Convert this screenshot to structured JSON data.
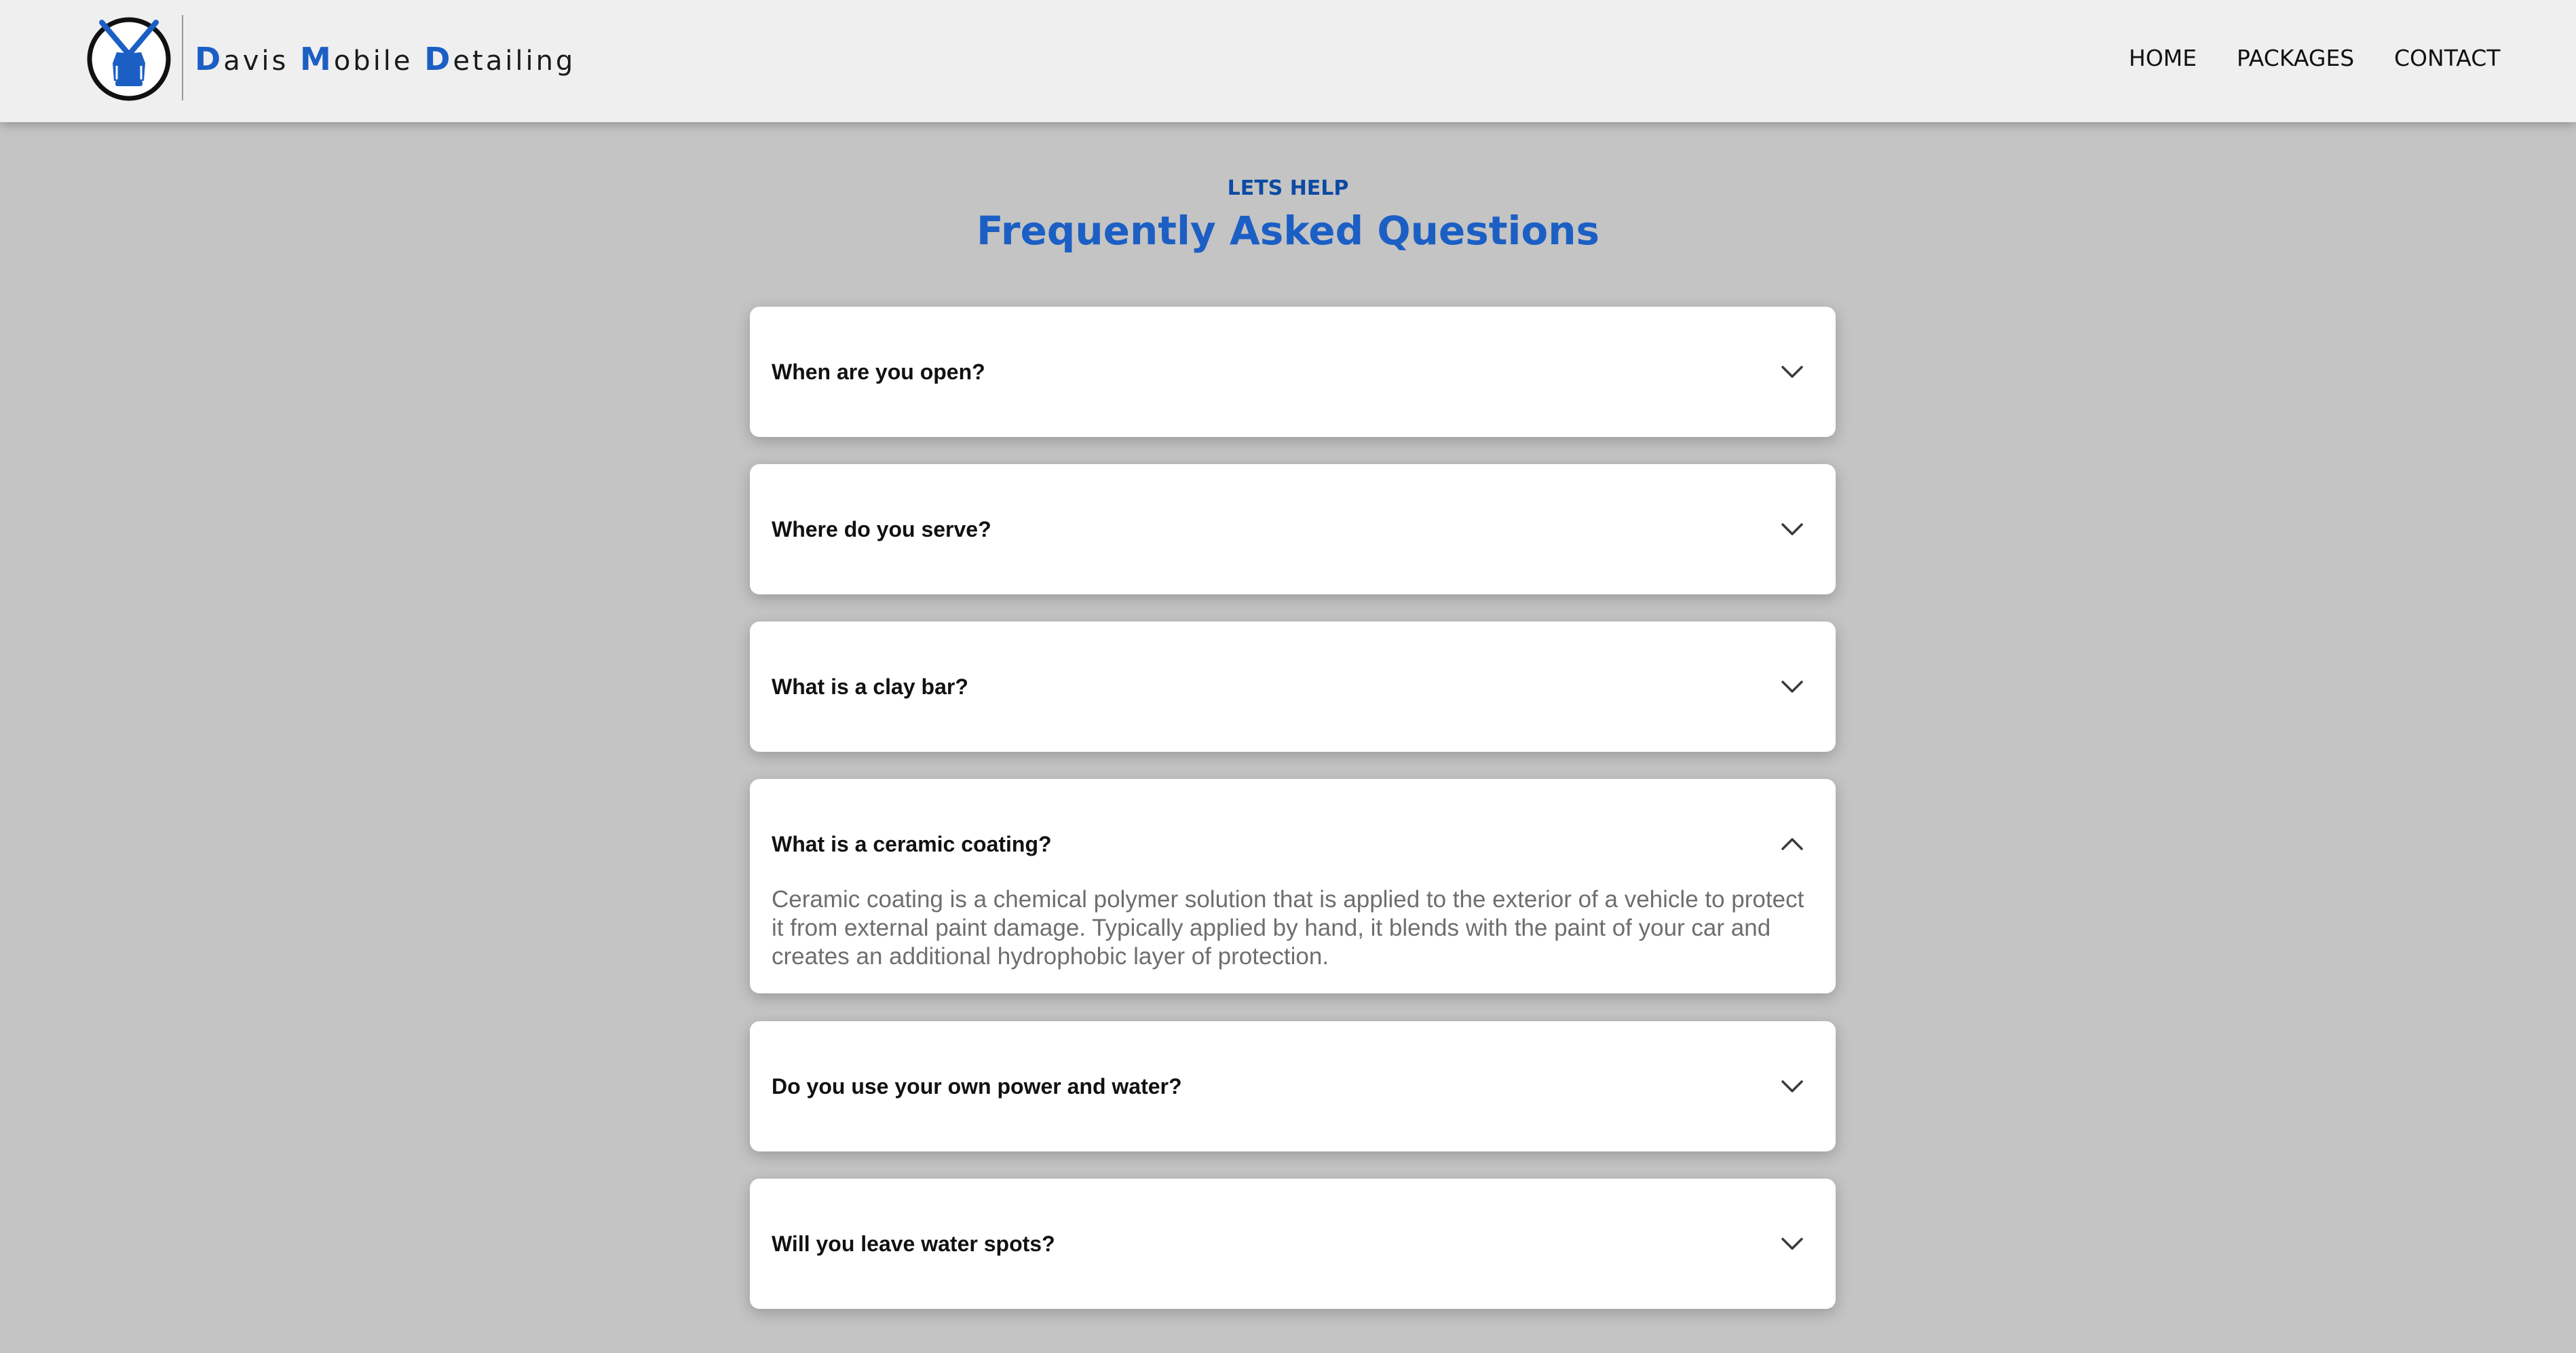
{
  "header": {
    "brand": {
      "initial_1": "D",
      "rest_1": "avis ",
      "initial_2": "M",
      "rest_2": "obile ",
      "initial_3": "D",
      "rest_3": "etailing"
    },
    "nav": {
      "home": "HOME",
      "packages": "PACKAGES",
      "contact": "CONTACT"
    }
  },
  "faq": {
    "eyebrow": "LETS HELP",
    "title": "Frequently Asked Questions",
    "items": [
      {
        "question": "When are you open?",
        "expanded": false
      },
      {
        "question": "Where do you serve?",
        "expanded": false
      },
      {
        "question": "What is a clay bar?",
        "expanded": false
      },
      {
        "question": "What is a ceramic coating?",
        "expanded": true,
        "answer": "Ceramic coating is a chemical polymer solution that is applied to the exterior of a vehicle to protect it from external paint damage. Typically applied by hand, it blends with the paint of your car and creates an additional hydrophobic layer of protection."
      },
      {
        "question": "Do you use your own power and water?",
        "expanded": false
      },
      {
        "question": "Will you leave water spots?",
        "expanded": false
      }
    ]
  },
  "colors": {
    "accent": "#1c5fc4",
    "eyebrow": "#0d4aa3",
    "page_background": "#c4c4c4",
    "header_background": "#efefef",
    "card_background": "#ffffff",
    "answer_text": "#6e6e6e"
  },
  "icons": {
    "logo": "crossed-pressure-washer-guns-logo-icon",
    "collapsed": "chevron-down-icon",
    "expanded": "chevron-up-icon"
  }
}
